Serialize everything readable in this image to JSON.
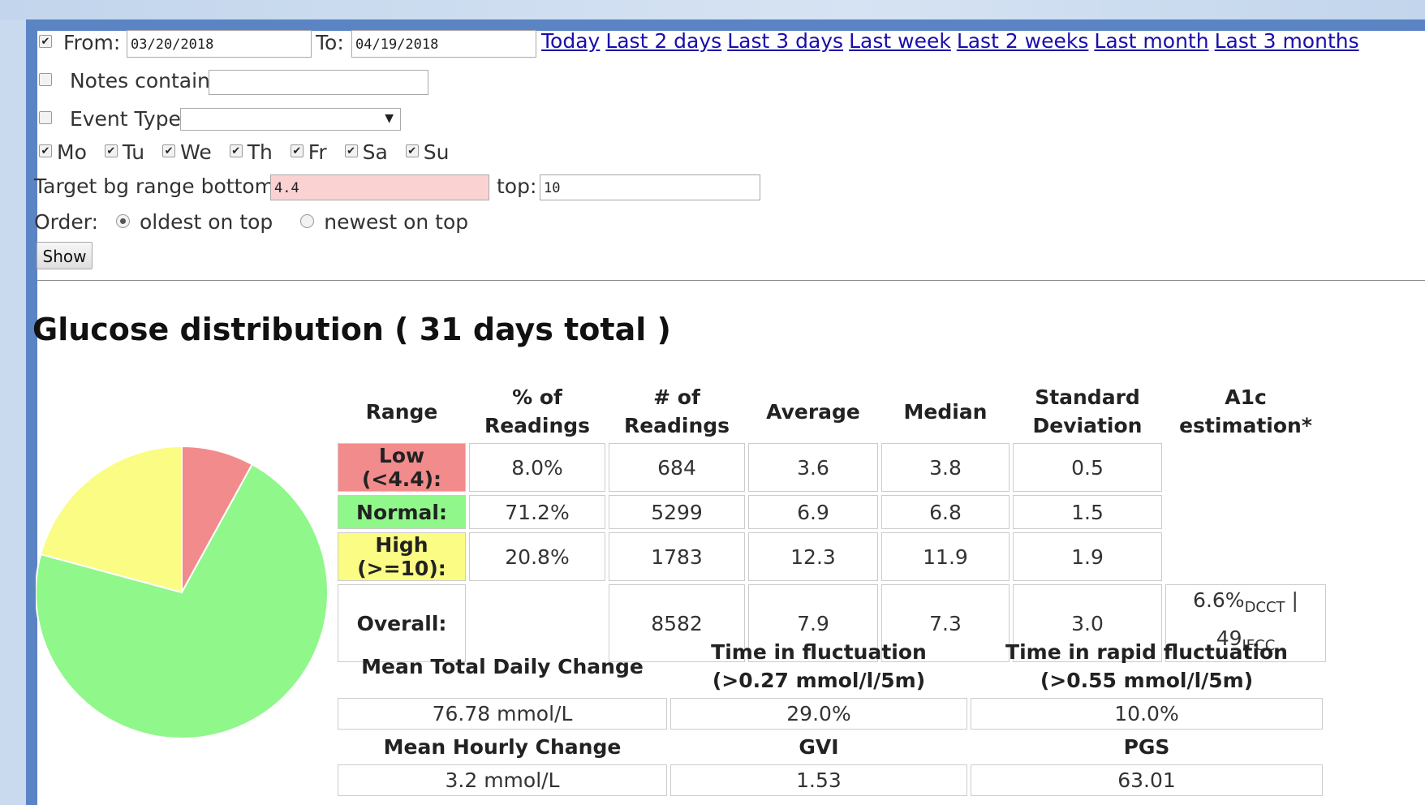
{
  "filters": {
    "from_label": "From:",
    "from_value": "03/20/2018",
    "to_label": "To:",
    "to_value": "04/19/2018",
    "quick_links": [
      "Today",
      "Last 2 days",
      "Last 3 days",
      "Last week",
      "Last 2 weeks",
      "Last month",
      "Last 3 months"
    ],
    "notes_label": "Notes contain:",
    "notes_value": "",
    "event_type_label": "Event Type:",
    "event_type_value": "",
    "days": [
      "Mo",
      "Tu",
      "We",
      "Th",
      "Fr",
      "Sa",
      "Su"
    ],
    "target_label": "Target bg range bottom:",
    "target_bottom": "4.4",
    "top_label": "top:",
    "target_top": "10",
    "order_label": "Order:",
    "order_oldest": "oldest on top",
    "order_newest": "newest on top",
    "show_button": "Show"
  },
  "title": "Glucose distribution ( 31 days total )",
  "distribution": {
    "headers": {
      "range": "Range",
      "pct_1": "% of",
      "pct_2": "Readings",
      "num_1": "# of",
      "num_2": "Readings",
      "avg": "Average",
      "median": "Median",
      "sd_1": "Standard",
      "sd_2": "Deviation",
      "a1c_1": "A1c",
      "a1c_2": "estimation*"
    },
    "rows": [
      {
        "label": "Low (<4.4):",
        "pct": "8.0%",
        "count": "684",
        "avg": "3.6",
        "median": "3.8",
        "sd": "0.5"
      },
      {
        "label": "Normal:",
        "pct": "71.2%",
        "count": "5299",
        "avg": "6.9",
        "median": "6.8",
        "sd": "1.5"
      },
      {
        "label": "High (>=10):",
        "pct": "20.8%",
        "count": "1783",
        "avg": "12.3",
        "median": "11.9",
        "sd": "1.9"
      }
    ],
    "overall": {
      "label": "Overall:",
      "count": "8582",
      "avg": "7.9",
      "median": "7.3",
      "sd": "3.0",
      "a1c_dcct": "6.6%",
      "dcct": "DCCT",
      "sep": " |",
      "a1c_ifcc": "49",
      "ifcc": "IFCC"
    },
    "colors": {
      "low": "#f28b8b",
      "normal": "#90f78a",
      "high": "#fbfc84"
    }
  },
  "stats": {
    "mtdc_label": "Mean Total Daily Change",
    "mtdc_value": "76.78 mmol/L",
    "fluct_label_1": "Time in fluctuation",
    "fluct_label_2": "(>0.27 mmol/l/5m)",
    "fluct_value": "29.0%",
    "rapid_label_1": "Time in rapid fluctuation",
    "rapid_label_2": "(>0.55 mmol/l/5m)",
    "rapid_value": "10.0%",
    "mhc_label": "Mean Hourly Change",
    "mhc_value": "3.2 mmol/L",
    "gvi_label": "GVI",
    "gvi_value": "1.53",
    "pgs_label": "PGS",
    "pgs_value": "63.01"
  },
  "chart_data": {
    "type": "pie",
    "categories": [
      "Low",
      "Normal",
      "High"
    ],
    "values": [
      8.0,
      71.2,
      20.8
    ],
    "colors": [
      "#f28b8b",
      "#90f78a",
      "#fbfc84"
    ]
  }
}
